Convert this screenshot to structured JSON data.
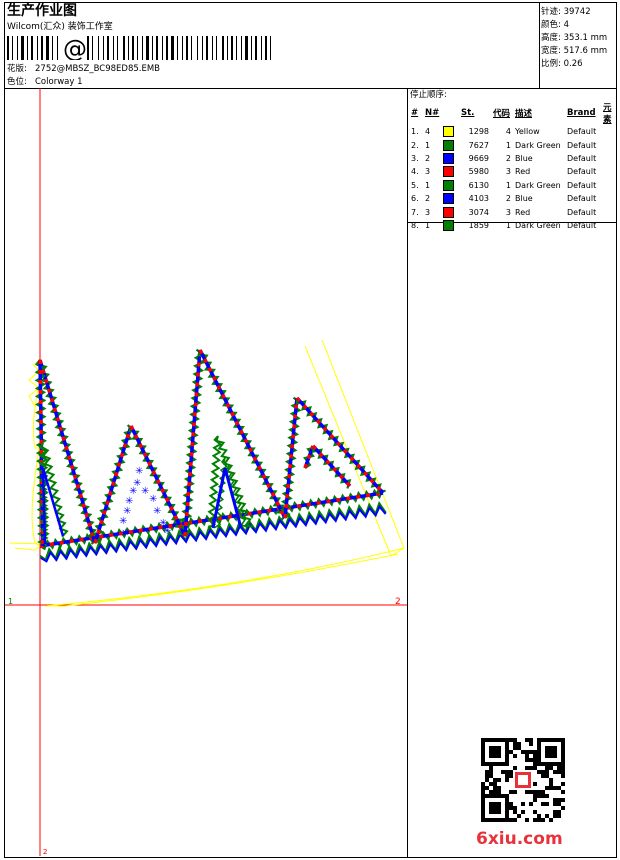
{
  "header": {
    "title": "生产作业图",
    "subtitle": "Wilcom(汇众) 装饰工作室",
    "design_label": "花版:",
    "design_value": "2752@MBSZ_BC98ED85.EMB",
    "colorway_label": "色位:",
    "colorway_value": "Colorway 1"
  },
  "stats": [
    {
      "label": "针迹:",
      "value": "39742"
    },
    {
      "label": "颜色:",
      "value": "4"
    },
    {
      "label": "高度:",
      "value": "353.1 mm"
    },
    {
      "label": "宽度:",
      "value": "517.6 mm"
    },
    {
      "label": "比例:",
      "value": "0.26"
    }
  ],
  "stop_sequence": {
    "heading": "停止顺序:",
    "columns": [
      "#",
      "N#",
      "St.",
      "代码",
      "描述",
      "Brand",
      "元素"
    ],
    "rows": [
      {
        "idx": "1.",
        "n": "4",
        "color": "#ffff00",
        "st": "1298",
        "code": "4",
        "desc": "Yellow",
        "brand": "Default"
      },
      {
        "idx": "2.",
        "n": "1",
        "color": "#008000",
        "st": "7627",
        "code": "1",
        "desc": "Dark Green",
        "brand": "Default"
      },
      {
        "idx": "3.",
        "n": "2",
        "color": "#0000ff",
        "st": "9669",
        "code": "2",
        "desc": "Blue",
        "brand": "Default"
      },
      {
        "idx": "4.",
        "n": "3",
        "color": "#ff0000",
        "st": "5980",
        "code": "3",
        "desc": "Red",
        "brand": "Default"
      },
      {
        "idx": "5.",
        "n": "1",
        "color": "#008000",
        "st": "6130",
        "code": "1",
        "desc": "Dark Green",
        "brand": "Default"
      },
      {
        "idx": "6.",
        "n": "2",
        "color": "#0000ff",
        "st": "4103",
        "code": "2",
        "desc": "Blue",
        "brand": "Default"
      },
      {
        "idx": "7.",
        "n": "3",
        "color": "#ff0000",
        "st": "3074",
        "code": "3",
        "desc": "Red",
        "brand": "Default"
      },
      {
        "idx": "8.",
        "n": "1",
        "color": "#008000",
        "st": "1859",
        "code": "1",
        "desc": "Dark Green",
        "brand": "Default"
      }
    ]
  },
  "axis_labels": {
    "origin": "1",
    "x_end": "2",
    "y_end": "2"
  },
  "watermark": "6xiu.com",
  "colors": {
    "red": "#ff0000",
    "blue": "#0000ff",
    "green": "#008000",
    "yellow": "#ffff00",
    "brand": "#e8323a"
  }
}
